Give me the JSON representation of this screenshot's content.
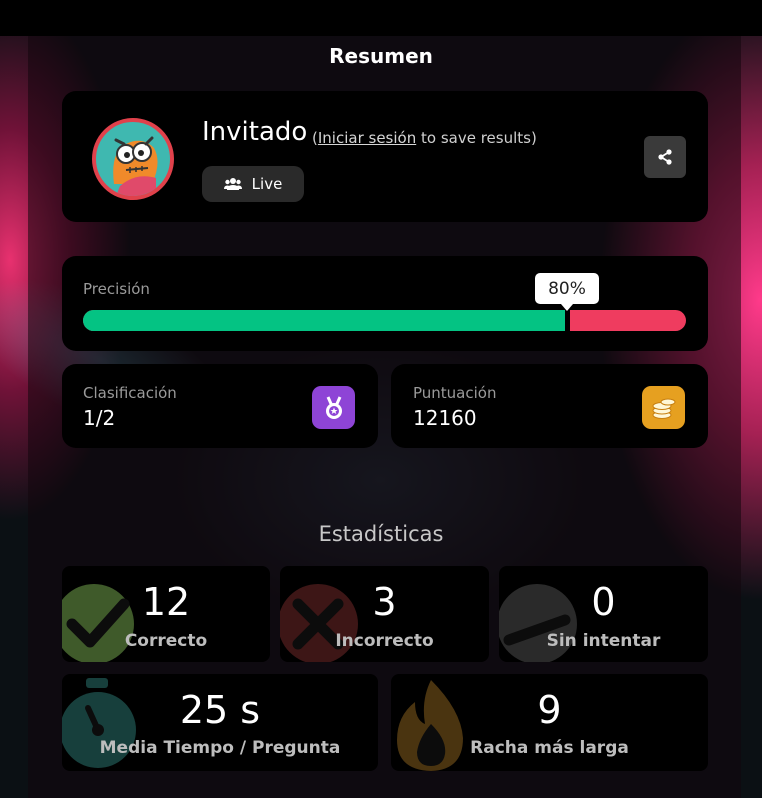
{
  "header": {
    "title": "Resumen"
  },
  "profile": {
    "name": "Invitado",
    "login_prefix": "(",
    "login_link": "Iniciar sesión",
    "login_suffix": " to save results)",
    "live_label": "Live",
    "avatar_icon": "monster-avatar-icon",
    "share_icon": "share-icon"
  },
  "precision": {
    "label": "Precisión",
    "percent_label": "80%",
    "correct_fraction": 0.8,
    "colors": {
      "correct": "#04c383",
      "incorrect": "#ef3c5f"
    }
  },
  "ranking": {
    "label": "Clasificación",
    "value": "1/2",
    "icon": "medal-icon",
    "color": "#8e44d6"
  },
  "score": {
    "label": "Puntuación",
    "value": "12160",
    "icon": "coins-icon",
    "color": "#e6a020"
  },
  "stats": {
    "title": "Estadísticas",
    "correct": {
      "value": "12",
      "label": "Correcto",
      "icon": "check-icon"
    },
    "incorrect": {
      "value": "3",
      "label": "Incorrecto",
      "icon": "cross-icon"
    },
    "unattempted": {
      "value": "0",
      "label": "Sin intentar",
      "icon": "dash-icon"
    },
    "avg_time": {
      "value": "25 s",
      "label": "Media Tiempo / Pregunta",
      "icon": "stopwatch-icon"
    },
    "streak": {
      "value": "9",
      "label": "Racha más larga",
      "icon": "flame-icon"
    }
  }
}
